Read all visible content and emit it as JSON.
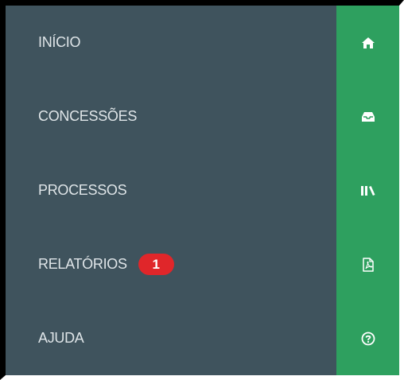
{
  "menu": {
    "items": [
      {
        "label": "INÍCIO",
        "icon": "home-icon"
      },
      {
        "label": "CONCESSÕES",
        "icon": "inbox-tray-icon"
      },
      {
        "label": "PROCESSOS",
        "icon": "books-icon"
      },
      {
        "label": "RELATÓRIOS",
        "icon": "pdf-file-icon",
        "badge": "1"
      },
      {
        "label": "AJUDA",
        "icon": "help-circle-icon"
      }
    ]
  },
  "colors": {
    "menu_background": "#3f535d",
    "rail_background": "#2ea05f",
    "badge_background": "#e0262a",
    "label_text": "#dfe5e8"
  }
}
